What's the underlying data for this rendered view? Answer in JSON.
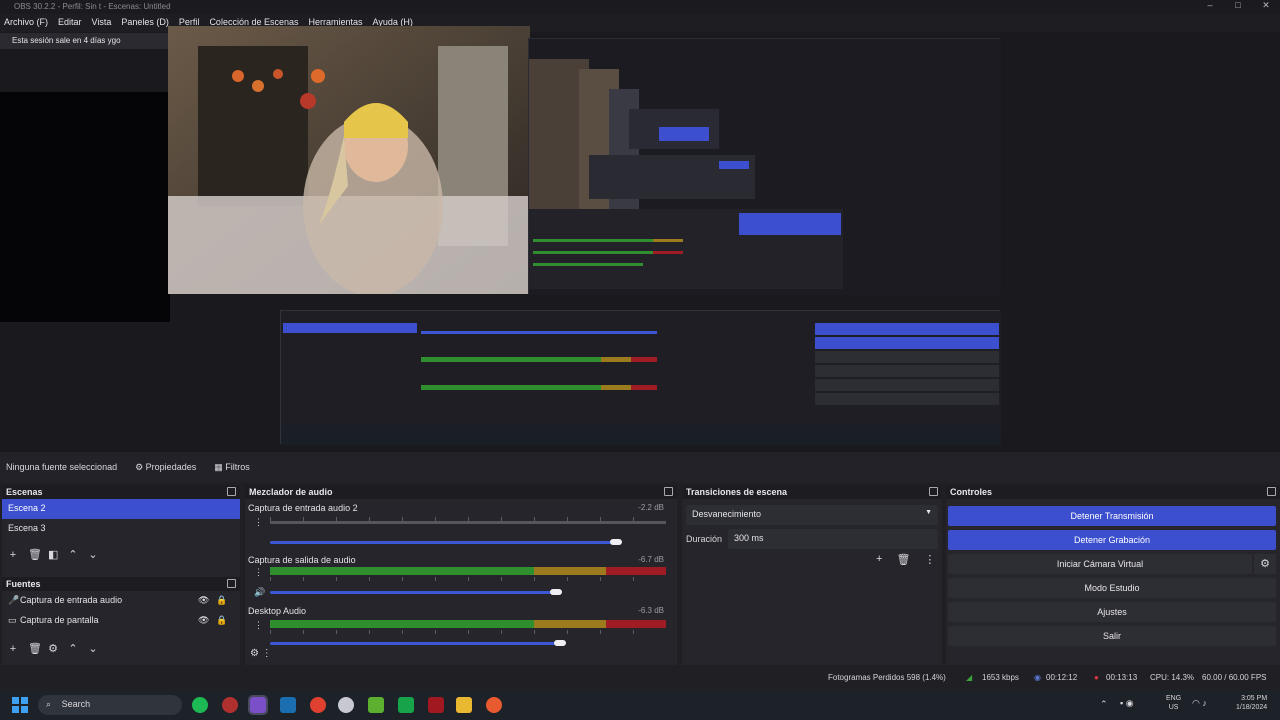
{
  "window": {
    "title": "OBS 30.2.2 - Perfil: Sin t - Escenas: Untitled"
  },
  "menu": [
    "Archivo (F)",
    "Editar",
    "Vista",
    "Paneles (D)",
    "Perfil",
    "Colección de Escenas",
    "Herramientas",
    "Ayuda (H)"
  ],
  "notice": "Esta sesión sale en 4 días ygo",
  "source_bar": {
    "none_selected": "Ninguna fuente seleccionad",
    "properties": "Propiedades",
    "filters": "Filtros"
  },
  "scenes": {
    "title": "Escenas",
    "items": [
      "Escena 2",
      "Escena 3"
    ],
    "selected": 0
  },
  "sources": {
    "title": "Fuentes",
    "items": [
      "Captura de entrada audio",
      "Captura de pantalla"
    ]
  },
  "mixer": {
    "title": "Mezclador de audio",
    "tracks": [
      {
        "name": "Captura de entrada audio 2",
        "db": "-2.2 dB",
        "volume": 0.9
      },
      {
        "name": "Captura de salida de audio",
        "db": "-6.7 dB",
        "volume": 0.75
      },
      {
        "name": "Desktop Audio",
        "db": "-6.3 dB",
        "volume": 0.75
      }
    ]
  },
  "transitions": {
    "title": "Transiciones de escena",
    "type": "Desvanecimiento",
    "duration_label": "Duración",
    "duration": "300 ms"
  },
  "controls": {
    "title": "Controles",
    "buttons": [
      "Detener Transmisión",
      "Detener Grabación",
      "Iniciar Cámara Virtual",
      "Modo Estudio",
      "Ajustes",
      "Salir"
    ]
  },
  "status": {
    "dropped": "Fotogramas Perdidos 598 (1.4%)",
    "bitrate": "1653 kbps",
    "stream_time": "00:12:12",
    "rec_time": "00:13:13",
    "cpu": "CPU: 14.3%",
    "fps": "60.00 / 60.00 FPS"
  },
  "taskbar": {
    "search": "Search",
    "lang": "ENG",
    "region": "US",
    "time": "3:05 PM",
    "date": "1/18/2024"
  },
  "colors": {
    "accent": "#3b4fcf",
    "meter_green": "#2f8f2f",
    "meter_yellow": "#9c7a1e",
    "meter_red": "#9f1c24"
  }
}
